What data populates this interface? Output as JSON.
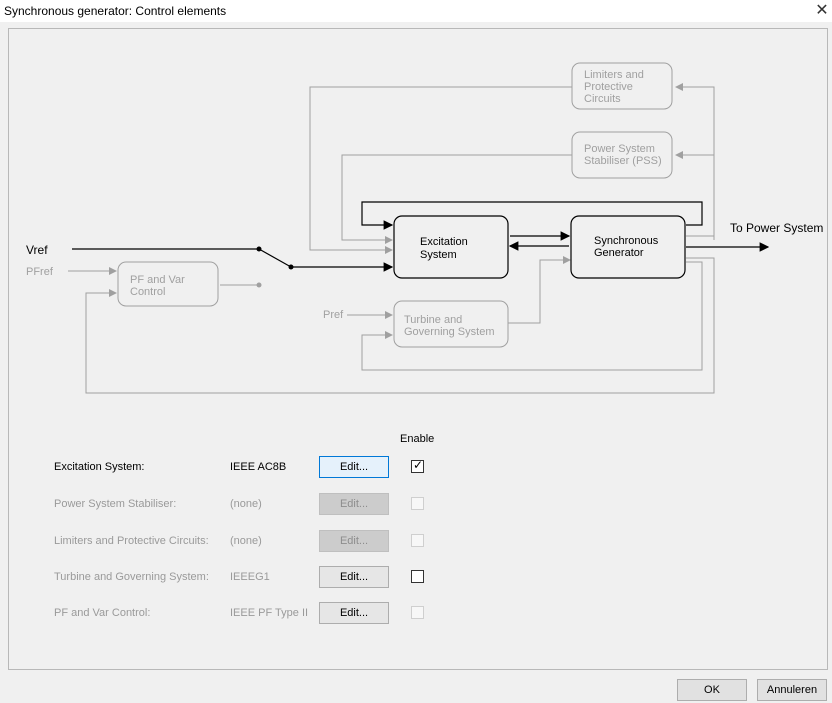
{
  "window": {
    "title": "Synchronous generator: Control elements",
    "close_glyph": "✕"
  },
  "diagram": {
    "vref": "Vref",
    "pfref": "PFref",
    "pref": "Pref",
    "to_power_system": "To Power System",
    "pf_var_block": [
      "PF and Var",
      "Control"
    ],
    "limiters_block": [
      "Limiters and",
      "Protective",
      "Circuits"
    ],
    "pss_block": [
      "Power System",
      "Stabiliser (PSS)"
    ],
    "excitation_block": [
      "Excitation",
      "System"
    ],
    "generator_block": [
      "Synchronous",
      "Generator"
    ],
    "turbine_block": [
      "Turbine and",
      "Governing System"
    ]
  },
  "enable_header": "Enable",
  "rows": [
    {
      "label": "Excitation System:",
      "value": "IEEE AC8B",
      "button": "Edit...",
      "enabled": true,
      "focused": true,
      "checked": true
    },
    {
      "label": "Power System Stabiliser:",
      "value": "(none)",
      "button": "Edit...",
      "enabled": false,
      "checked": false
    },
    {
      "label": "Limiters and Protective Circuits:",
      "value": "(none)",
      "button": "Edit...",
      "enabled": false,
      "checked": false
    },
    {
      "label": "Turbine and Governing System:",
      "value": "IEEEG1",
      "button": "Edit...",
      "enabled": true,
      "checked": false,
      "checkbox_enabled": true,
      "label_gray": true
    },
    {
      "label": "PF and Var Control:",
      "value": "IEEE PF Type II",
      "button": "Edit...",
      "enabled": true,
      "checked": false,
      "checkbox_enabled": false,
      "label_gray": true
    }
  ],
  "footer": {
    "ok": "OK",
    "cancel": "Annuleren"
  },
  "colors": {
    "active": "#000000",
    "inactive": "#a0a0a0"
  }
}
